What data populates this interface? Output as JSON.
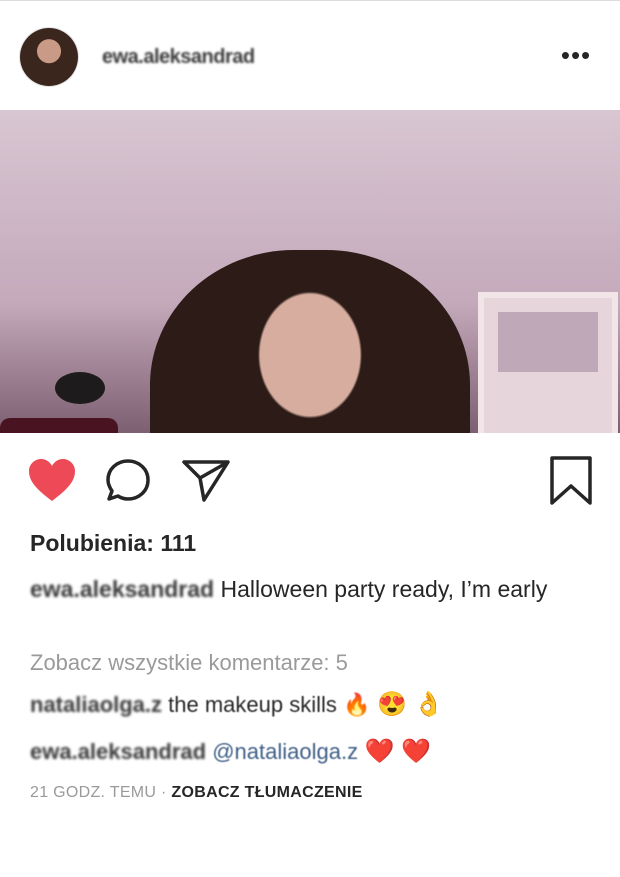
{
  "post": {
    "username": "ewa.aleksandrad",
    "more_label": "•••",
    "likes_text": "Polubienia: 111",
    "caption_user": "ewa.aleksandrad",
    "caption_text": " Halloween party ready, I’m early",
    "view_comments": "Zobacz wszystkie komentarze: 5",
    "comments": [
      {
        "user": "nataliaolga.z",
        "text": " the makeup skills 🔥",
        "emoji": " 😍 👌"
      },
      {
        "user": "ewa.aleksandrad",
        "mention": " @nataliaolga.z",
        "emoji": " ❤️ ❤️"
      }
    ],
    "time": "21 GODZ. TEMU",
    "separator": " · ",
    "translate": "ZOBACZ TŁUMACZENIE"
  },
  "icons": {
    "like": "heart-icon",
    "comment": "comment-icon",
    "share": "send-icon",
    "save": "bookmark-icon"
  },
  "colors": {
    "heart": "#ed4956",
    "mention": "#3f5f86",
    "muted": "#9a9a9a"
  }
}
